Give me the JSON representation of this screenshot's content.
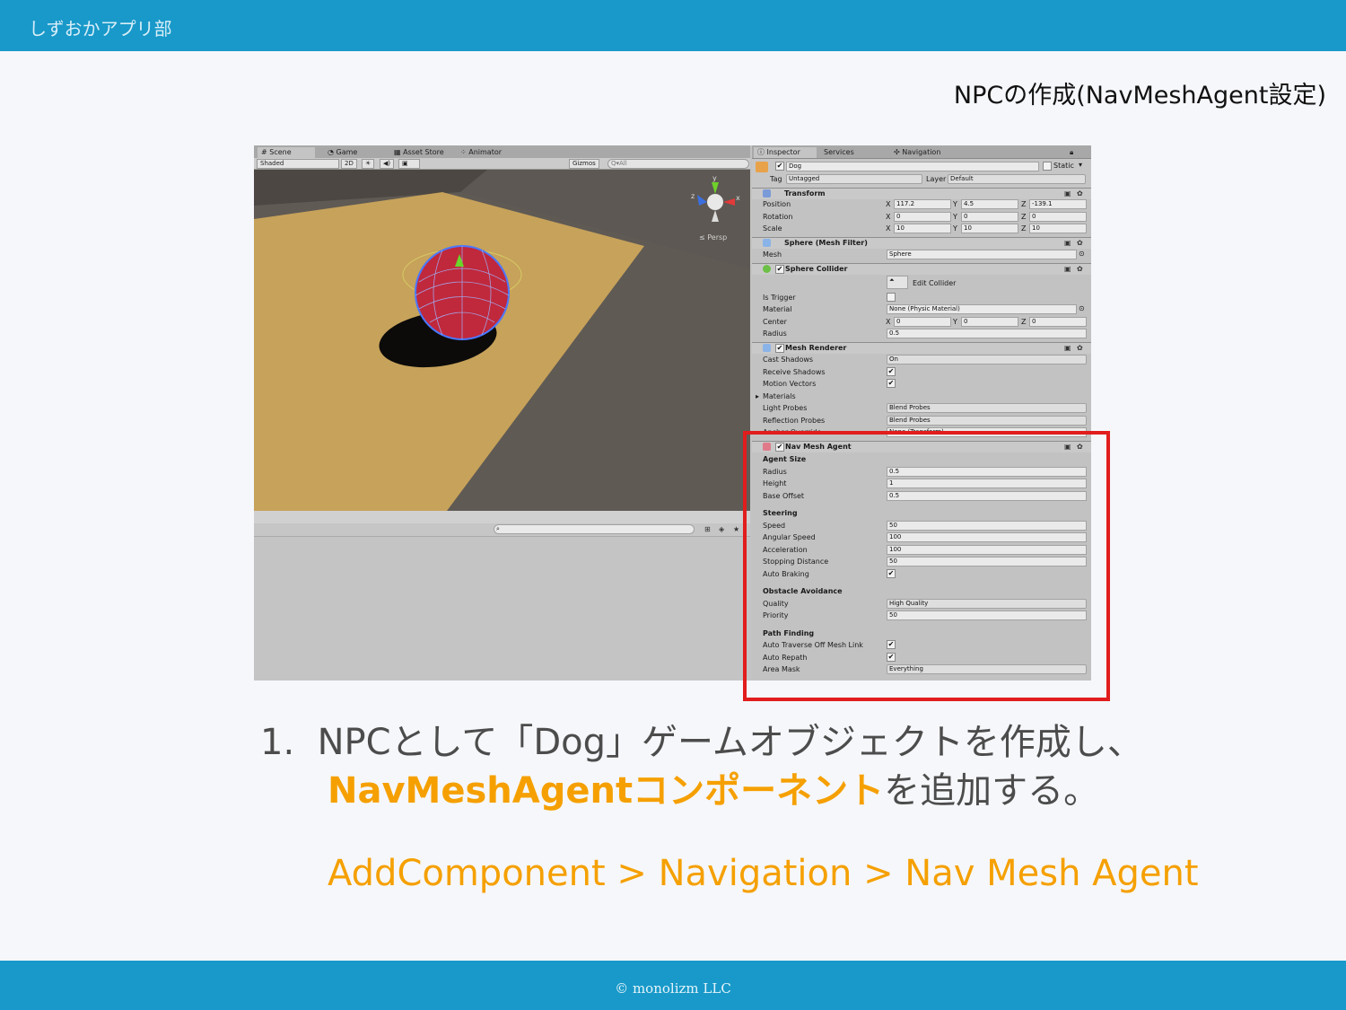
{
  "header": {
    "brand": "しずおかアプリ部"
  },
  "slide": {
    "title": "NPCの作成(NavMeshAgent設定)"
  },
  "screenshot": {
    "scene_tabs": [
      "Scene",
      "Game",
      "Asset Store",
      "Animator"
    ],
    "toolbar": {
      "shading": "Shaded",
      "mode_2d": "2D",
      "gizmos": "Gizmos",
      "search_placeholder": "Q▾All"
    },
    "persp_label": "≤ Persp",
    "gizmo_axes": {
      "y": "y",
      "x": "x",
      "z": "z"
    },
    "inspector_tabs": [
      "Inspector",
      "Services",
      "Navigation"
    ],
    "object": {
      "name": "Dog",
      "static_label": "Static",
      "tag_label": "Tag",
      "tag_value": "Untagged",
      "layer_label": "Layer",
      "layer_value": "Default"
    },
    "transform": {
      "title": "Transform",
      "rows": [
        {
          "label": "Position",
          "x": "117.2",
          "y": "4.5",
          "z": "-139.1"
        },
        {
          "label": "Rotation",
          "x": "0",
          "y": "0",
          "z": "0"
        },
        {
          "label": "Scale",
          "x": "10",
          "y": "10",
          "z": "10"
        }
      ]
    },
    "mesh_filter": {
      "title": "Sphere (Mesh Filter)",
      "mesh_label": "Mesh",
      "mesh_value": "Sphere"
    },
    "sphere_collider": {
      "title": "Sphere Collider",
      "edit_label": "Edit Collider",
      "is_trigger": "Is Trigger",
      "material_label": "Material",
      "material_value": "None (Physic Material)",
      "center_label": "Center",
      "center": {
        "x": "0",
        "y": "0",
        "z": "0"
      },
      "radius_label": "Radius",
      "radius": "0.5"
    },
    "mesh_renderer": {
      "title": "Mesh Renderer",
      "rows": [
        {
          "label": "Cast Shadows",
          "value": "On",
          "kind": "dropdown"
        },
        {
          "label": "Receive Shadows",
          "value": "✔",
          "kind": "check"
        },
        {
          "label": "Motion Vectors",
          "value": "✔",
          "kind": "check"
        },
        {
          "label": "Materials",
          "value": "",
          "kind": "fold"
        },
        {
          "label": "Light Probes",
          "value": "Blend Probes",
          "kind": "dropdown"
        },
        {
          "label": "Reflection Probes",
          "value": "Blend Probes",
          "kind": "dropdown"
        },
        {
          "label": "Anchor Override",
          "value": "None (Transform)",
          "kind": "field"
        }
      ]
    },
    "nav_mesh_agent": {
      "title": "Nav Mesh Agent",
      "agent_size": "Agent Size",
      "size_rows": [
        {
          "label": "Radius",
          "value": "0.5"
        },
        {
          "label": "Height",
          "value": "1"
        },
        {
          "label": "Base Offset",
          "value": "0.5"
        }
      ],
      "steering": "Steering",
      "steering_rows": [
        {
          "label": "Speed",
          "value": "50"
        },
        {
          "label": "Angular Speed",
          "value": "100"
        },
        {
          "label": "Acceleration",
          "value": "100"
        },
        {
          "label": "Stopping Distance",
          "value": "50"
        }
      ],
      "auto_braking": "Auto Braking",
      "obstacle": "Obstacle Avoidance",
      "quality_label": "Quality",
      "quality_value": "High Quality",
      "priority_label": "Priority",
      "priority_value": "50",
      "path_finding": "Path Finding",
      "auto_traverse": "Auto Traverse Off Mesh Link",
      "auto_repath": "Auto Repath",
      "area_mask_label": "Area Mask",
      "area_mask_value": "Everything"
    }
  },
  "instruction": {
    "number": "1.",
    "line1": "NPCとして「Dog」ゲームオブジェクトを作成し、",
    "highlight": "NavMeshAgentコンポーネント",
    "line2_rest": "を追加する。",
    "path": "AddComponent > Navigation > Nav Mesh Agent"
  },
  "footer": {
    "copyright": "© monolizm LLC"
  },
  "colors": {
    "bar": "#1899c9",
    "highlight": "#f5a000",
    "box": "#e11d1d"
  }
}
